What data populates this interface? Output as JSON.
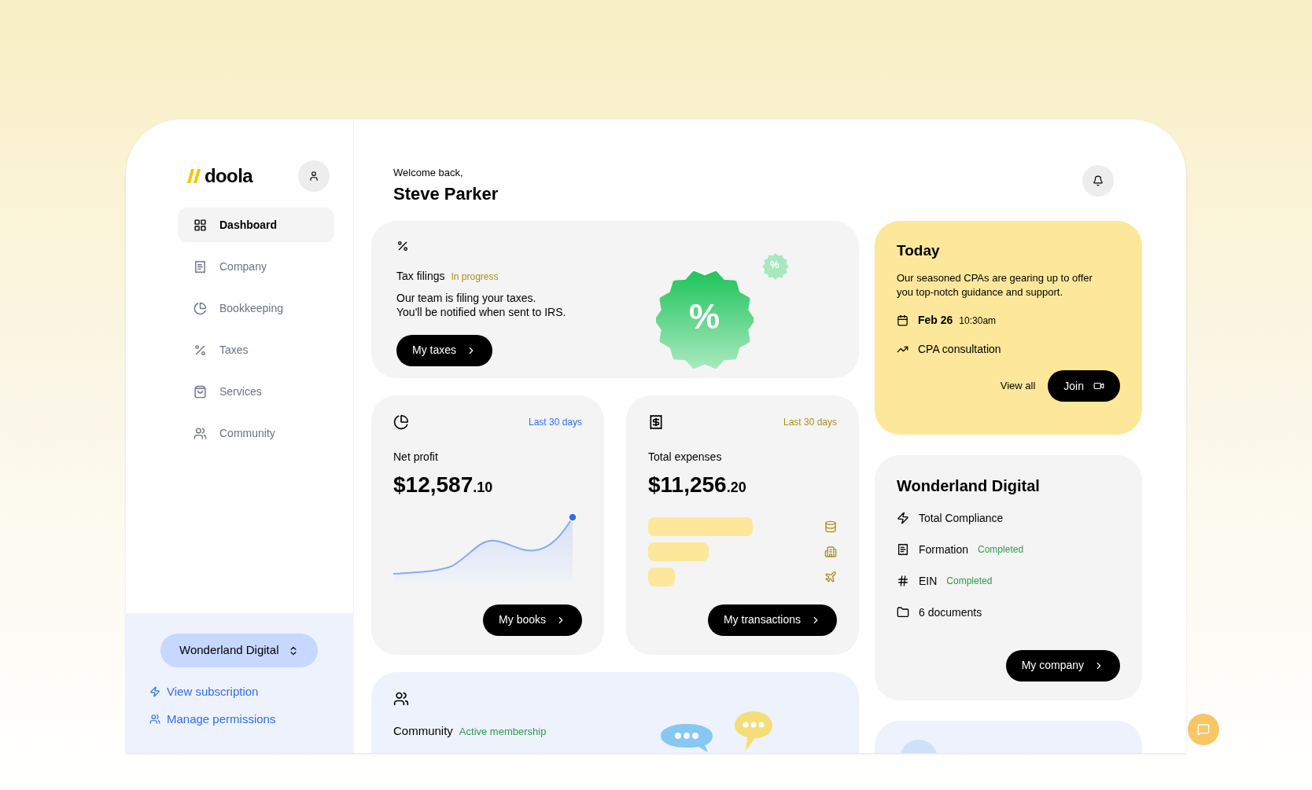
{
  "brand": {
    "name": "doola"
  },
  "sidebar": {
    "items": [
      {
        "label": "Dashboard",
        "selected": true
      },
      {
        "label": "Company",
        "selected": false
      },
      {
        "label": "Bookkeeping",
        "selected": false
      },
      {
        "label": "Taxes",
        "selected": false
      },
      {
        "label": "Services",
        "selected": false
      },
      {
        "label": "Community",
        "selected": false
      }
    ],
    "workspace": "Wonderland Digital",
    "links": [
      "View subscription",
      "Manage permissions"
    ]
  },
  "header": {
    "greeting": "Welcome back,",
    "name": "Steve Parker"
  },
  "tax_card": {
    "title": "Tax filings",
    "status": "In progress",
    "lines": [
      "Our team is filing your taxes.",
      "You'll be notified when sent to IRS."
    ],
    "button": "My taxes",
    "badge": "%",
    "small_badge": "%"
  },
  "profit_card": {
    "period": "Last 30 days",
    "label": "Net profit",
    "amount": "$12,587",
    "cents": ".10",
    "button": "My books"
  },
  "expenses_card": {
    "period": "Last 30 days",
    "label": "Total expenses",
    "amount": "$11,256",
    "cents": ".20",
    "button": "My transactions"
  },
  "today_card": {
    "title": "Today",
    "text": "Our seasoned CPAs are gearing up to offer you top-notch guidance and support.",
    "date": "Feb 26",
    "time": "10:30am",
    "event": "CPA consultation",
    "view_all": "View all",
    "join": "Join"
  },
  "company_card": {
    "title": "Wonderland Digital",
    "items": [
      {
        "label": "Total Compliance"
      },
      {
        "label": "Formation",
        "status": "Completed"
      },
      {
        "label": "EIN",
        "status": "Completed"
      },
      {
        "label": "6 documents"
      }
    ],
    "button": "My company"
  },
  "community_card": {
    "title": "Community",
    "status": "Active membership"
  }
}
